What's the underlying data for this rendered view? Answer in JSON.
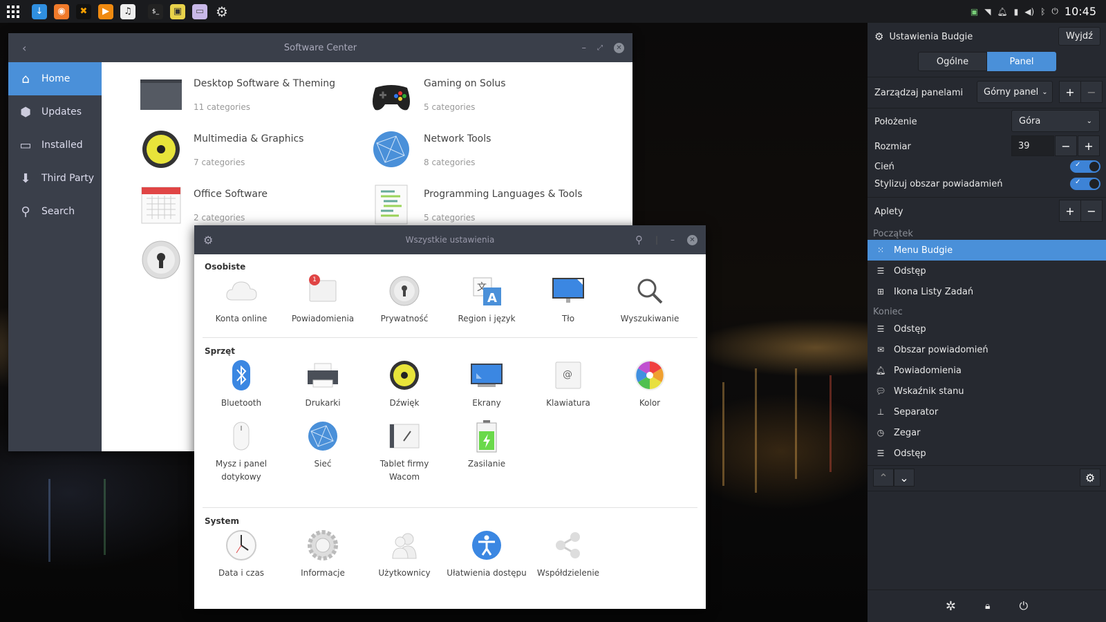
{
  "top_panel": {
    "clock": "10:45"
  },
  "software_center": {
    "title": "Software Center",
    "sidebar": [
      {
        "label": "Home",
        "icon": "home-icon",
        "active": true
      },
      {
        "label": "Updates",
        "icon": "updates-icon",
        "active": false
      },
      {
        "label": "Installed",
        "icon": "monitor-icon",
        "active": false
      },
      {
        "label": "Third Party",
        "icon": "download-arrow-icon",
        "active": false
      },
      {
        "label": "Search",
        "icon": "search-icon",
        "active": false
      }
    ],
    "categories": [
      {
        "name": "Desktop Software & Theming",
        "count": "11 categories"
      },
      {
        "name": "Gaming on Solus",
        "count": "5 categories"
      },
      {
        "name": "Multimedia & Graphics",
        "count": "7 categories"
      },
      {
        "name": "Network Tools",
        "count": "8 categories"
      },
      {
        "name": "Office Software",
        "count": "2 categories"
      },
      {
        "name": "Programming Languages & Tools",
        "count": "5 categories"
      }
    ]
  },
  "settings": {
    "title": "Wszystkie ustawienia",
    "sections": {
      "personal": {
        "title": "Osobiste",
        "items": [
          "Konta online",
          "Powiadomienia",
          "Prywatność",
          "Region i język",
          "Tło",
          "Wyszukiwanie"
        ],
        "notification_badge": "1"
      },
      "hardware": {
        "title": "Sprzęt",
        "items": [
          "Bluetooth",
          "Drukarki",
          "Dźwięk",
          "Ekrany",
          "Klawiatura",
          "Kolor"
        ],
        "items2": [
          "Mysz i panel dotykowy",
          "Sieć",
          "Tablet firmy Wacom",
          "Zasilanie"
        ]
      },
      "system": {
        "title": "System",
        "items": [
          "Data i czas",
          "Informacje",
          "Użytkownicy",
          "Ułatwienia dostępu",
          "Współdzielenie"
        ]
      }
    }
  },
  "raven": {
    "title": "Ustawienia Budgie",
    "exit_button": "Wyjdź",
    "tabs": [
      "Ogólne",
      "Panel"
    ],
    "active_tab": "Panel",
    "manage_panels_label": "Zarządzaj panelami",
    "panel_select": "Górny panel",
    "position_label": "Położenie",
    "position_value": "Góra",
    "size_label": "Rozmiar",
    "size_value": "39",
    "shadow_label": "Cień",
    "shadow_on": true,
    "stylize_label": "Stylizuj obszar powiadamień",
    "stylize_on": true,
    "applets_label": "Aplety",
    "start_label": "Początek",
    "start_applets": [
      "Menu Budgie",
      "Odstęp",
      "Ikona Listy Zadań"
    ],
    "end_label": "Koniec",
    "end_applets": [
      "Odstęp",
      "Obszar powiadomień",
      "Powiadomienia",
      "Wskaźnik stanu",
      "Separator",
      "Zegar",
      "Odstęp"
    ],
    "accent": "#4a90d9"
  }
}
